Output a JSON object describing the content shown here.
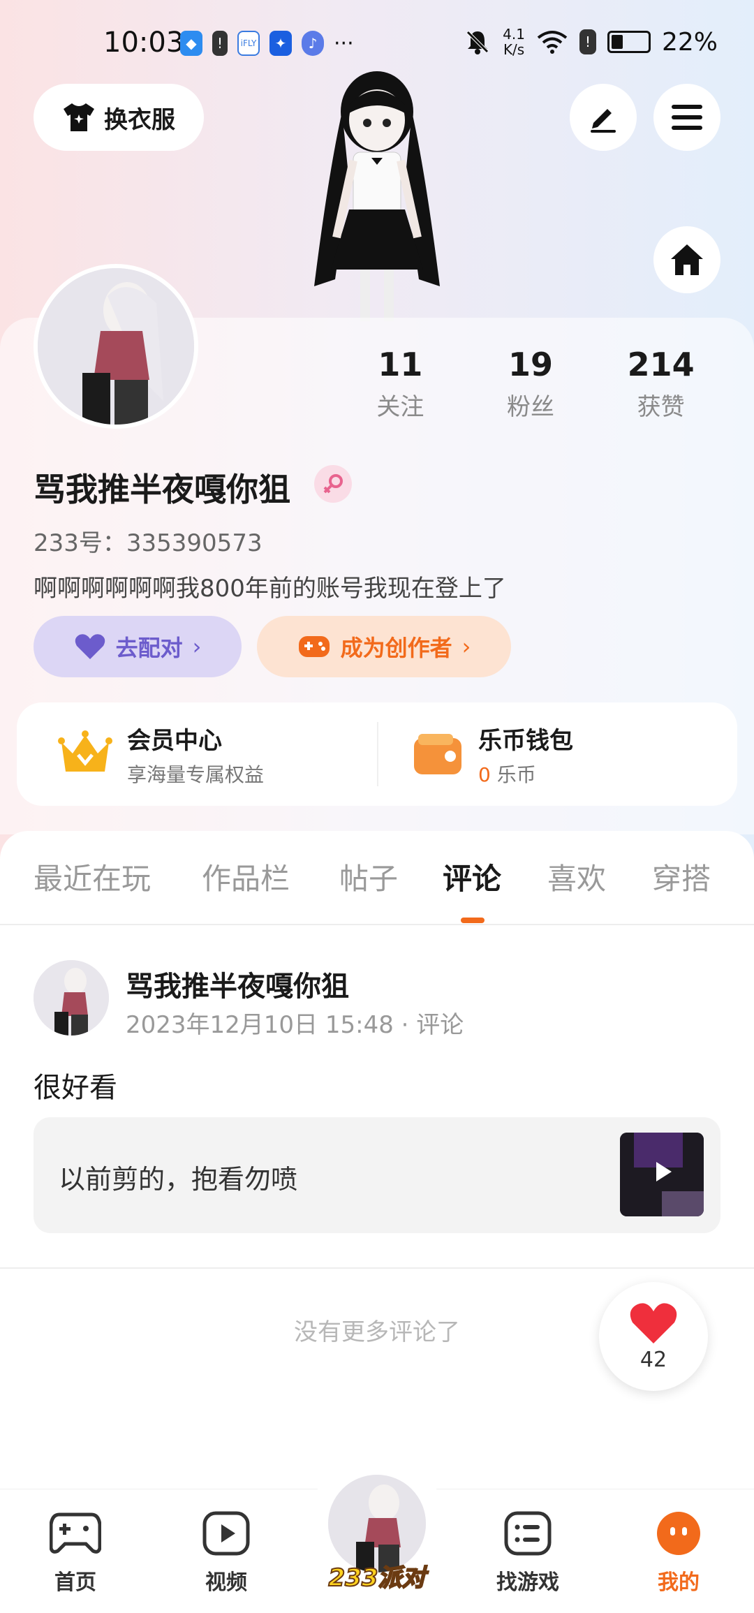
{
  "status_bar": {
    "time": "10:03",
    "net_speed_value": "4.1",
    "net_speed_unit": "K/s",
    "battery": "22%",
    "more": "···"
  },
  "header": {
    "change_outfit": "换衣服"
  },
  "profile": {
    "nickname": "骂我推半夜嘎你狙",
    "uid": "233号：335390573",
    "bio": "啊啊啊啊啊啊我800年前的账号我现在登上了",
    "stats": [
      {
        "value": "11",
        "label": "关注"
      },
      {
        "value": "19",
        "label": "粉丝"
      },
      {
        "value": "214",
        "label": "获赞"
      }
    ],
    "match_label": "去配对",
    "creator_label": "成为创作者"
  },
  "wallet": {
    "vip_title": "会员中心",
    "vip_sub": "享海量专属权益",
    "coin_title": "乐币钱包",
    "coin_count": "0",
    "coin_unit": "乐币"
  },
  "tabs": [
    "最近在玩",
    "作品栏",
    "帖子",
    "评论",
    "喜欢",
    "穿搭"
  ],
  "active_tab": "评论",
  "comment": {
    "author": "骂我推半夜嘎你狙",
    "meta": "2023年12月10日 15:48 · 评论",
    "text": "很好看",
    "quote": "以前剪的，抱看勿喷"
  },
  "no_more": "没有更多评论了",
  "like": {
    "count": "42"
  },
  "bottom_nav": {
    "home": "首页",
    "video": "视频",
    "center": "233派对",
    "find_game": "找游戏",
    "mine": "我的"
  },
  "colors": {
    "accent": "#f26a1b",
    "purple": "#6c5ccc"
  }
}
